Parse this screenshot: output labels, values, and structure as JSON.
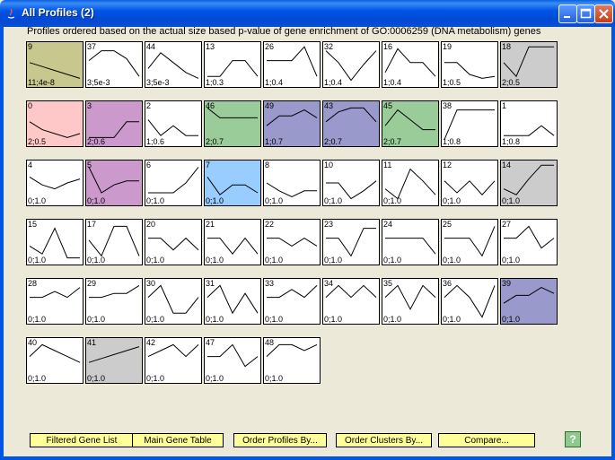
{
  "window": {
    "title": "All Profiles (2)"
  },
  "heading": "Profiles ordered based on the actual size based p-value of gene enrichment of GO:0006259 (DNA metabolism) genes",
  "profiles": [
    {
      "id": "9",
      "stat": "11;4e-8",
      "color": "#c8c88e",
      "pts": [
        0.55,
        0.45,
        0.35,
        0.25,
        0.15
      ]
    },
    {
      "id": "37",
      "stat": "3;5e-3",
      "color": "#ffffff",
      "pts": [
        0.6,
        0.85,
        0.85,
        0.65,
        0.2
      ]
    },
    {
      "id": "44",
      "stat": "3;5e-3",
      "color": "#ffffff",
      "pts": [
        0.4,
        0.8,
        0.55,
        0.3,
        0.15
      ]
    },
    {
      "id": "13",
      "stat": "1;0.3",
      "color": "#ffffff",
      "pts": [
        0.2,
        0.2,
        0.6,
        0.6,
        0.2
      ]
    },
    {
      "id": "26",
      "stat": "1;0.4",
      "color": "#ffffff",
      "pts": [
        0.6,
        0.6,
        0.6,
        0.95,
        0.2
      ]
    },
    {
      "id": "32",
      "stat": "1;0.4",
      "color": "#ffffff",
      "pts": [
        0.85,
        0.55,
        0.1,
        0.5,
        0.85
      ]
    },
    {
      "id": "16",
      "stat": "1;0.4",
      "color": "#ffffff",
      "pts": [
        0.3,
        0.9,
        0.55,
        0.55,
        0.2
      ]
    },
    {
      "id": "19",
      "stat": "1;0.5",
      "color": "#ffffff",
      "pts": [
        0.55,
        0.55,
        0.25,
        0.15,
        0.2
      ]
    },
    {
      "id": "18",
      "stat": "2;0.5",
      "color": "#cccccc",
      "pts": [
        0.55,
        0.2,
        0.95,
        0.95,
        0.95
      ]
    },
    {
      "id": "0",
      "stat": "2;0.5",
      "color": "#ffc8c8",
      "pts": [
        0.55,
        0.35,
        0.25,
        0.15,
        0.25
      ]
    },
    {
      "id": "3",
      "stat": "2;0.6",
      "color": "#cc99cc",
      "pts": [
        0.15,
        0.15,
        0.15,
        0.55,
        0.55
      ]
    },
    {
      "id": "2",
      "stat": "1;0.6",
      "color": "#ffffff",
      "pts": [
        0.6,
        0.2,
        0.45,
        0.2,
        0.2
      ]
    },
    {
      "id": "46",
      "stat": "2;0.7",
      "color": "#99cc99",
      "pts": [
        0.9,
        0.65,
        0.65,
        0.65,
        0.65
      ]
    },
    {
      "id": "49",
      "stat": "1;0.7",
      "color": "#9999cc",
      "pts": [
        0.45,
        0.7,
        0.7,
        0.85,
        0.65
      ]
    },
    {
      "id": "43",
      "stat": "2;0.7",
      "color": "#9999cc",
      "pts": [
        0.55,
        0.8,
        0.9,
        0.9,
        0.55
      ]
    },
    {
      "id": "45",
      "stat": "2;0.7",
      "color": "#99cc99",
      "pts": [
        0.45,
        0.85,
        0.6,
        0.35,
        0.35
      ]
    },
    {
      "id": "38",
      "stat": "1;0.8",
      "color": "#ffffff",
      "pts": [
        0.1,
        0.85,
        0.85,
        0.85,
        0.85
      ]
    },
    {
      "id": "1",
      "stat": "1;0.8",
      "color": "#ffffff",
      "pts": [
        0.2,
        0.2,
        0.2,
        0.45,
        0.2
      ]
    },
    {
      "id": "4",
      "stat": "0;1.0",
      "color": "#ffffff",
      "pts": [
        0.65,
        0.45,
        0.35,
        0.5,
        0.6
      ]
    },
    {
      "id": "5",
      "stat": "0;1.0",
      "color": "#cc99cc",
      "pts": [
        0.9,
        0.25,
        0.45,
        0.55,
        0.55
      ]
    },
    {
      "id": "6",
      "stat": "0;1.0",
      "color": "#ffffff",
      "pts": [
        0.25,
        0.25,
        0.25,
        0.5,
        0.9
      ]
    },
    {
      "id": "7",
      "stat": "0;1.0",
      "color": "#99ccff",
      "pts": [
        0.65,
        0.2,
        0.45,
        0.45,
        0.25
      ]
    },
    {
      "id": "8",
      "stat": "0;1.0",
      "color": "#ffffff",
      "pts": [
        0.5,
        0.3,
        0.15,
        0.3,
        0.3
      ]
    },
    {
      "id": "10",
      "stat": "0;1.0",
      "color": "#ffffff",
      "pts": [
        0.5,
        0.5,
        0.1,
        0.3,
        0.55
      ]
    },
    {
      "id": "11",
      "stat": "0;1.0",
      "color": "#ffffff",
      "pts": [
        0.35,
        0.1,
        0.85,
        0.55,
        0.2
      ]
    },
    {
      "id": "12",
      "stat": "0;1.0",
      "color": "#ffffff",
      "pts": [
        0.55,
        0.25,
        0.55,
        0.2,
        0.55
      ]
    },
    {
      "id": "14",
      "stat": "0;1.0",
      "color": "#cccccc",
      "pts": [
        0.35,
        0.2,
        0.6,
        0.95,
        0.95
      ]
    },
    {
      "id": "15",
      "stat": "0;1.0",
      "color": "#ffffff",
      "pts": [
        0.4,
        0.2,
        0.85,
        0.1,
        0.1
      ]
    },
    {
      "id": "17",
      "stat": "0;1.0",
      "color": "#ffffff",
      "pts": [
        0.55,
        0.15,
        0.9,
        0.9,
        0.15
      ]
    },
    {
      "id": "20",
      "stat": "0;1.0",
      "color": "#ffffff",
      "pts": [
        0.6,
        0.6,
        0.3,
        0.6,
        0.3
      ]
    },
    {
      "id": "21",
      "stat": "0;1.0",
      "color": "#ffffff",
      "pts": [
        0.6,
        0.6,
        0.2,
        0.6,
        0.2
      ]
    },
    {
      "id": "22",
      "stat": "0;1.0",
      "color": "#ffffff",
      "pts": [
        0.6,
        0.6,
        0.4,
        0.6,
        0.4
      ]
    },
    {
      "id": "23",
      "stat": "0;1.0",
      "color": "#ffffff",
      "pts": [
        0.6,
        0.6,
        0.15,
        0.85,
        0.85
      ]
    },
    {
      "id": "24",
      "stat": "0;1.0",
      "color": "#ffffff",
      "pts": [
        0.6,
        0.6,
        0.6,
        0.6,
        0.2
      ]
    },
    {
      "id": "25",
      "stat": "0;1.0",
      "color": "#ffffff",
      "pts": [
        0.6,
        0.6,
        0.6,
        0.15,
        0.9
      ]
    },
    {
      "id": "27",
      "stat": "0;1.0",
      "color": "#ffffff",
      "pts": [
        0.6,
        0.6,
        0.9,
        0.35,
        0.6
      ]
    },
    {
      "id": "28",
      "stat": "0;1.0",
      "color": "#ffffff",
      "pts": [
        0.6,
        0.6,
        0.75,
        0.6,
        0.85
      ]
    },
    {
      "id": "29",
      "stat": "0;1.0",
      "color": "#ffffff",
      "pts": [
        0.6,
        0.6,
        0.7,
        0.7,
        0.9
      ]
    },
    {
      "id": "30",
      "stat": "0;1.0",
      "color": "#ffffff",
      "pts": [
        0.6,
        0.9,
        0.2,
        0.2,
        0.6
      ]
    },
    {
      "id": "31",
      "stat": "0;1.0",
      "color": "#ffffff",
      "pts": [
        0.6,
        0.9,
        0.2,
        0.7,
        0.2
      ]
    },
    {
      "id": "33",
      "stat": "0;1.0",
      "color": "#ffffff",
      "pts": [
        0.6,
        0.6,
        0.8,
        0.6,
        0.9
      ]
    },
    {
      "id": "34",
      "stat": "0;1.0",
      "color": "#ffffff",
      "pts": [
        0.6,
        0.9,
        0.6,
        0.9,
        0.6
      ]
    },
    {
      "id": "35",
      "stat": "0;1.0",
      "color": "#ffffff",
      "pts": [
        0.6,
        0.9,
        0.3,
        0.9,
        0.6
      ]
    },
    {
      "id": "36",
      "stat": "0;1.0",
      "color": "#ffffff",
      "pts": [
        0.6,
        0.9,
        0.6,
        0.1,
        0.9
      ]
    },
    {
      "id": "39",
      "stat": "0;1.0",
      "color": "#9999cc",
      "pts": [
        0.45,
        0.65,
        0.65,
        0.85,
        0.7
      ]
    },
    {
      "id": "40",
      "stat": "0;1.0",
      "color": "#ffffff",
      "pts": [
        0.6,
        0.9,
        0.75,
        0.6,
        0.45
      ]
    },
    {
      "id": "41",
      "stat": "0;1.0",
      "color": "#cccccc",
      "pts": [
        0.45,
        0.55,
        0.65,
        0.75,
        0.85
      ]
    },
    {
      "id": "42",
      "stat": "0;1.0",
      "color": "#ffffff",
      "pts": [
        0.6,
        0.75,
        0.9,
        0.6,
        0.9
      ]
    },
    {
      "id": "47",
      "stat": "0;1.0",
      "color": "#ffffff",
      "pts": [
        0.6,
        0.6,
        0.9,
        0.35,
        0.6
      ]
    },
    {
      "id": "48",
      "stat": "0;1.0",
      "color": "#ffffff",
      "pts": [
        0.6,
        0.9,
        0.9,
        0.75,
        0.9
      ]
    }
  ],
  "buttons": {
    "filtered_gene_list": "Filtered Gene List",
    "main_gene_table": "Main Gene Table",
    "order_profiles_by": "Order Profiles By...",
    "order_clusters_by": "Order Clusters By...",
    "compare": "Compare..."
  },
  "help_label": "?"
}
